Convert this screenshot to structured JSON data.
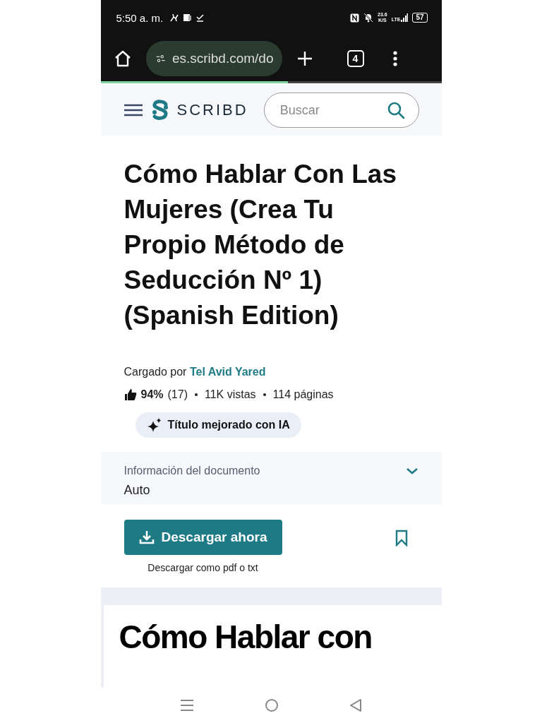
{
  "status_bar": {
    "time": "5:50 a. m.",
    "speed": "23.6",
    "speed_unit": "K/S",
    "network": "LTE",
    "battery": "57"
  },
  "browser": {
    "url": "es.scribd.com/do",
    "tab_count": "4",
    "load_progress": {
      "level": 0.55
    }
  },
  "header": {
    "logo": "SCRIBD",
    "search": {
      "placeholder": "Buscar"
    }
  },
  "document": {
    "title": "Cómo Hablar Con Las Mujeres (Crea Tu Propio Método de Seducción Nº 1) (Spanish Edition)",
    "uploaded_label": "Cargado por",
    "uploader": "Tel Avid Yared",
    "rating": "94%",
    "rating_count": "(17)",
    "views": "11K vistas",
    "pages": "114 páginas",
    "ai_badge": "Título mejorado con IA"
  },
  "info_panel": {
    "label": "Información del documento",
    "value": "Auto",
    "expanded": false
  },
  "download": {
    "button": "Descargar ahora",
    "caption": "Descargar como pdf o txt",
    "saved": false
  },
  "preview": {
    "text": "Cómo Hablar con"
  }
}
